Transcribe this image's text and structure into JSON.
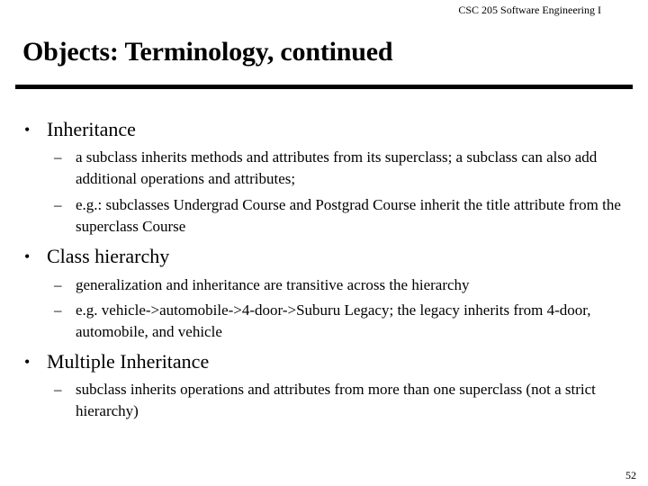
{
  "header": {
    "course": "CSC 205 Software Engineering I"
  },
  "slide": {
    "title": "Objects: Terminology, continued",
    "bullets": [
      {
        "label": "Inheritance",
        "subs": [
          "a subclass inherits methods and attributes from its superclass; a subclass can also add additional operations and attributes;",
          "e.g.: subclasses Undergrad Course and Postgrad Course inherit the title attribute from the superclass Course"
        ]
      },
      {
        "label": "Class hierarchy",
        "subs": [
          "generalization and inheritance are transitive across the hierarchy",
          "e.g. vehicle->automobile->4-door->Suburu Legacy; the legacy inherits from 4-door, automobile, and vehicle"
        ]
      },
      {
        "label": "Multiple Inheritance",
        "subs": [
          "subclass inherits operations and attributes from more than one superclass (not a strict hierarchy)"
        ]
      }
    ],
    "bullet_glyph": "•",
    "dash_glyph": "–"
  },
  "footer": {
    "page_number": "52"
  }
}
